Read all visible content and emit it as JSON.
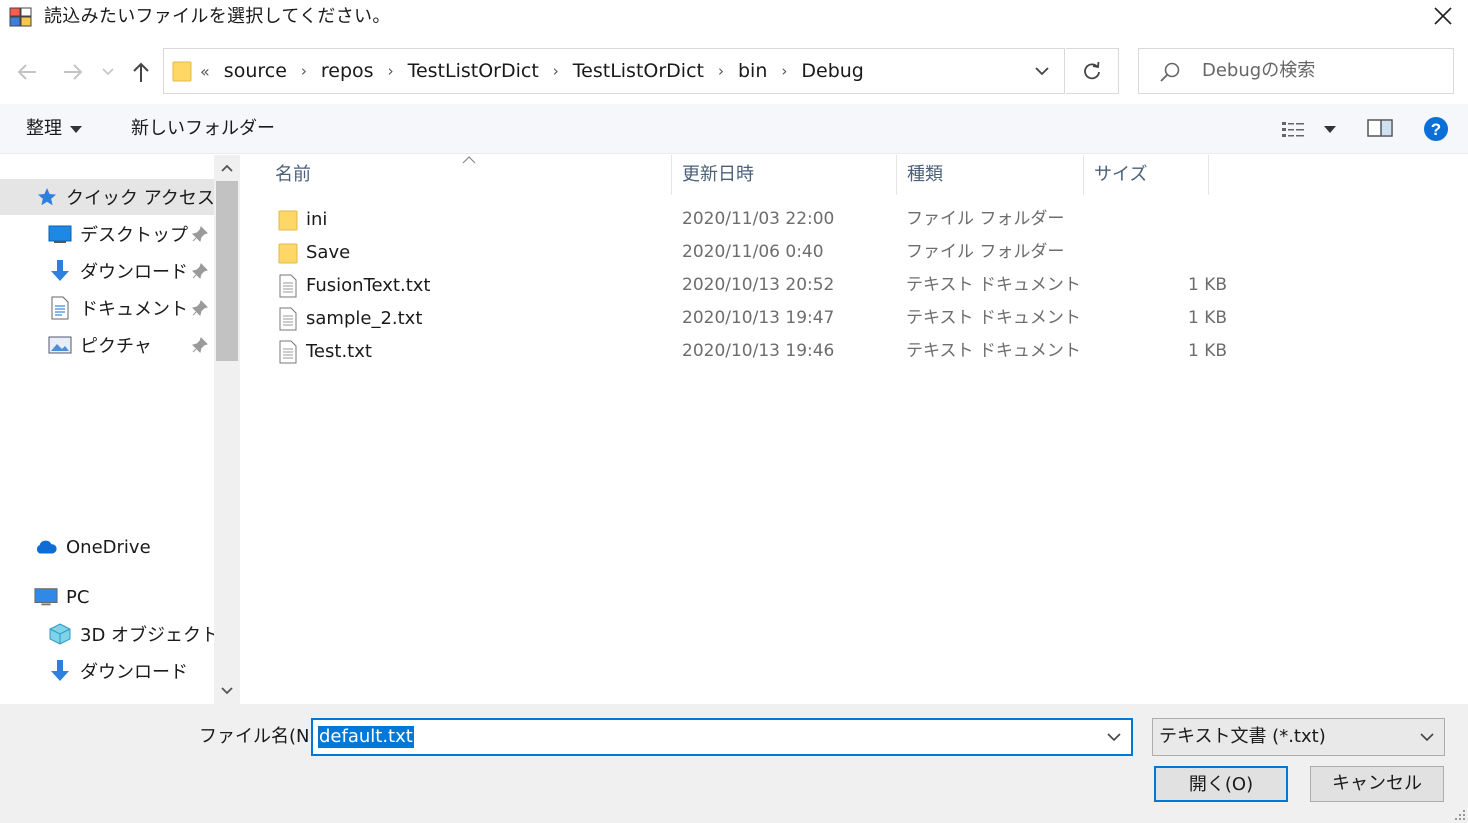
{
  "window": {
    "title": "読込みたいファイルを選択してください。"
  },
  "nav": {
    "breadcrumb_lead": "«",
    "breadcrumbs": [
      "source",
      "repos",
      "TestListOrDict",
      "TestListOrDict",
      "bin",
      "Debug"
    ],
    "search_placeholder": "Debugの検索"
  },
  "toolbar": {
    "organize_label": "整理",
    "new_folder_label": "新しいフォルダー"
  },
  "sidebar": {
    "quick_access": "クイック アクセス",
    "quick_items": [
      {
        "label": "デスクトップ",
        "icon": "desktop-icon"
      },
      {
        "label": "ダウンロード",
        "icon": "download-icon"
      },
      {
        "label": "ドキュメント",
        "icon": "documents-icon"
      },
      {
        "label": "ピクチャ",
        "icon": "pictures-icon"
      }
    ],
    "onedrive": "OneDrive",
    "pc": "PC",
    "pc_items": [
      {
        "label": "3D オブジェクト",
        "icon": "3d-objects-icon"
      },
      {
        "label": "ダウンロード",
        "icon": "download-icon"
      }
    ]
  },
  "filelist": {
    "columns": [
      "名前",
      "更新日時",
      "種類",
      "サイズ"
    ],
    "rows": [
      {
        "name": "ini",
        "date": "2020/11/03 22:00",
        "type": "ファイル フォルダー",
        "size": "",
        "kind": "folder"
      },
      {
        "name": "Save",
        "date": "2020/11/06 0:40",
        "type": "ファイル フォルダー",
        "size": "",
        "kind": "folder"
      },
      {
        "name": "FusionText.txt",
        "date": "2020/10/13 20:52",
        "type": "テキスト ドキュメント",
        "size": "1 KB",
        "kind": "file"
      },
      {
        "name": "sample_2.txt",
        "date": "2020/10/13 19:47",
        "type": "テキスト ドキュメント",
        "size": "1 KB",
        "kind": "file"
      },
      {
        "name": "Test.txt",
        "date": "2020/10/13 19:46",
        "type": "テキスト ドキュメント",
        "size": "1 KB",
        "kind": "file"
      }
    ]
  },
  "bottom": {
    "filename_label": "ファイル名(N):",
    "filename_value": "default.txt",
    "filetype_value": "テキスト文書 (*.txt)",
    "open_label": "開く(O)",
    "cancel_label": "キャンセル"
  },
  "colors": {
    "accent": "#0078d7",
    "folder": "#ffd766",
    "selected_nav": "#e5e5e5"
  }
}
